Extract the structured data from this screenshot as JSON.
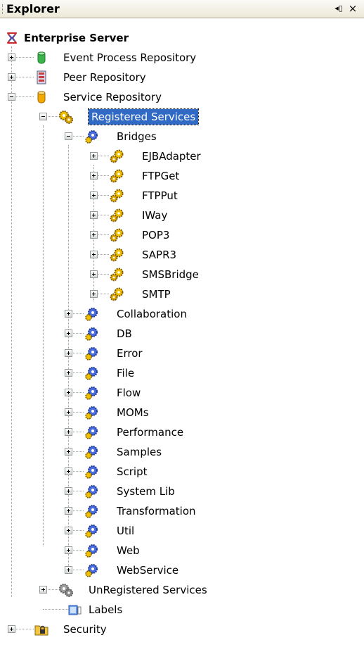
{
  "panel": {
    "title": "Explorer",
    "pin_glyph": "◂▯",
    "close_glyph": "×"
  },
  "tree": {
    "root": "Enterprise Server",
    "event_process_repository": "Event Process Repository",
    "peer_repository": "Peer Repository",
    "service_repository": "Service Repository",
    "registered_services": "Registered Services",
    "bridges": {
      "label": "Bridges",
      "items": [
        "EJBAdapter",
        "FTPGet",
        "FTPPut",
        "IWay",
        "POP3",
        "SAPR3",
        "SMSBridge",
        "SMTP"
      ]
    },
    "categories": [
      "Collaboration",
      "DB",
      "Error",
      "File",
      "Flow",
      "MOMs",
      "Performance",
      "Samples",
      "Script",
      "System Lib",
      "Transformation",
      "Util",
      "Web",
      "WebService"
    ],
    "unregistered_services": "UnRegistered Services",
    "labels": "Labels",
    "security": "Security"
  },
  "colors": {
    "selection": "#316ac5",
    "green_cylinder": "#3cb24a",
    "orange_cylinder": "#f2a900",
    "gear_gold": "#f0c000",
    "gear_blue": "#4a6ee0",
    "gray_gear": "#8c8c8c"
  }
}
